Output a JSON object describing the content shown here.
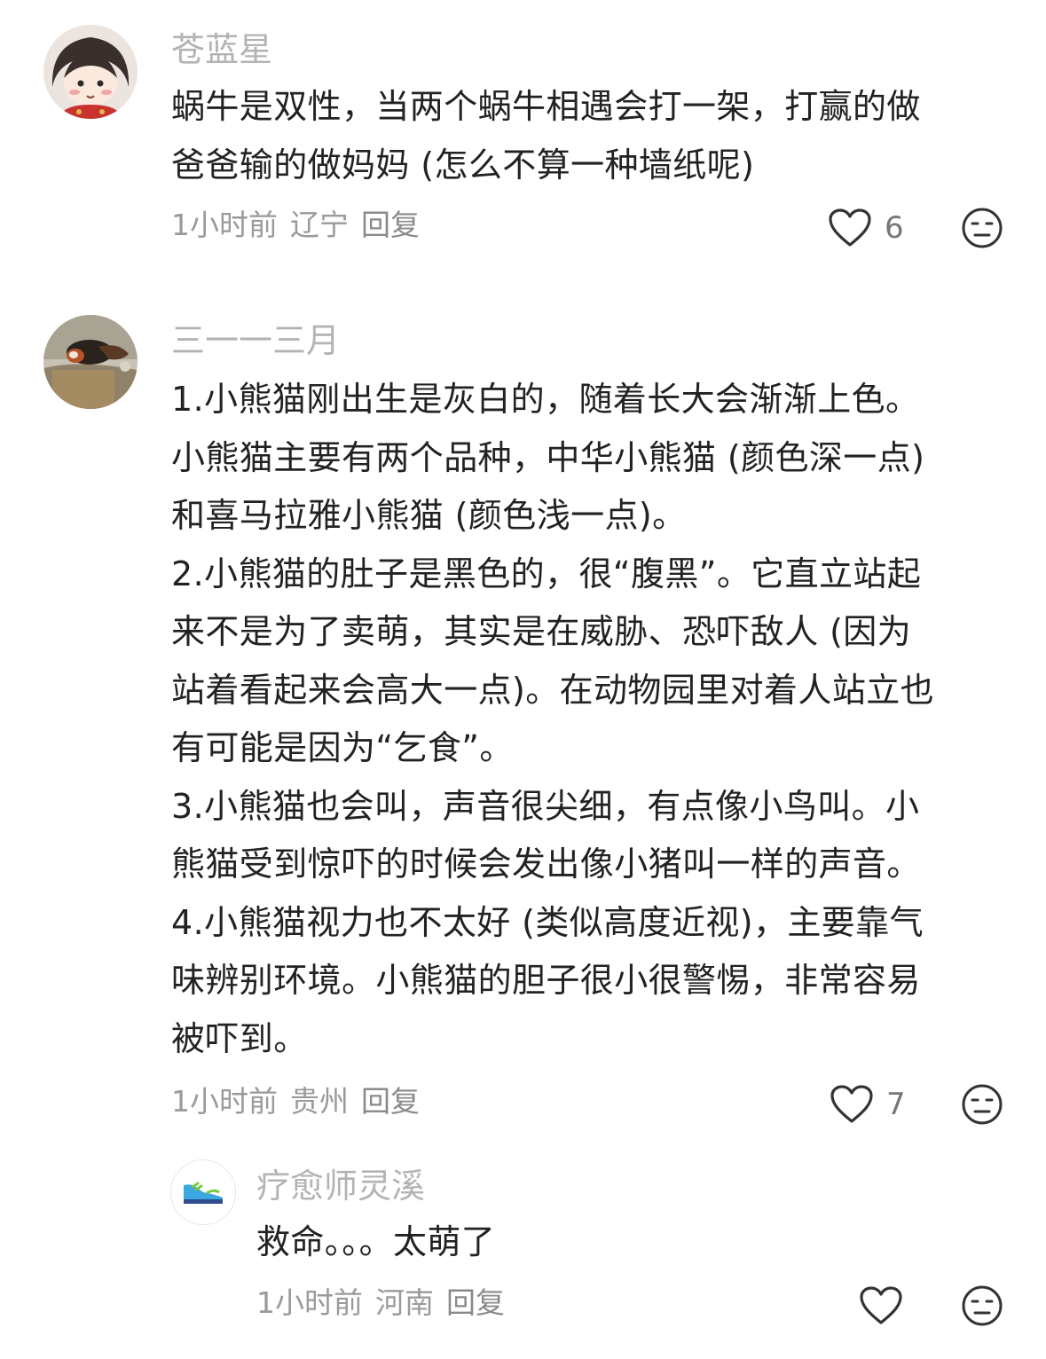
{
  "comments": [
    {
      "username": "苍蓝星",
      "lines": [
        "蜗牛是双性，当两个蜗牛相遇会打一架，打赢的做",
        "爸爸输的做妈妈 (怎么不算一种墙纸呢)"
      ],
      "time": "1小时前",
      "location": "辽宁",
      "reply_label": "回复",
      "likes": "6"
    },
    {
      "username": "三一一三月",
      "lines": [
        "1.小熊猫刚出生是灰白的，随着长大会渐渐上色。",
        "小熊猫主要有两个品种，中华小熊猫 (颜色深一点)",
        "和喜马拉雅小熊猫 (颜色浅一点)。",
        "2.小熊猫的肚子是黑色的，很“腹黑”。它直立站起",
        "来不是为了卖萌，其实是在威胁、恐吓敌人 (因为",
        "站着看起来会高大一点)。在动物园里对着人站立也",
        "有可能是因为“乞食”。",
        "3.小熊猫也会叫，声音很尖细，有点像小鸟叫。小",
        "熊猫受到惊吓的时候会发出像小猪叫一样的声音。",
        "4.小熊猫视力也不太好 (类似高度近视)，主要靠气",
        "味辨别环境。小熊猫的胆子很小很警惕，非常容易",
        "被吓到。"
      ],
      "time": "1小时前",
      "location": "贵州",
      "reply_label": "回复",
      "likes": "7"
    },
    {
      "username": "疗愈师灵溪",
      "lines": [
        "救命。。。太萌了"
      ],
      "time": "1小时前",
      "location": "河南",
      "reply_label": "回复",
      "likes": ""
    }
  ],
  "icons": {
    "like": "heart-outline-icon",
    "dislike": "neutral-face-icon"
  },
  "colors": {
    "username": "#b3b3b3",
    "body_text": "#222222",
    "meta": "#9a9a9a",
    "icon_stroke": "#333333"
  }
}
